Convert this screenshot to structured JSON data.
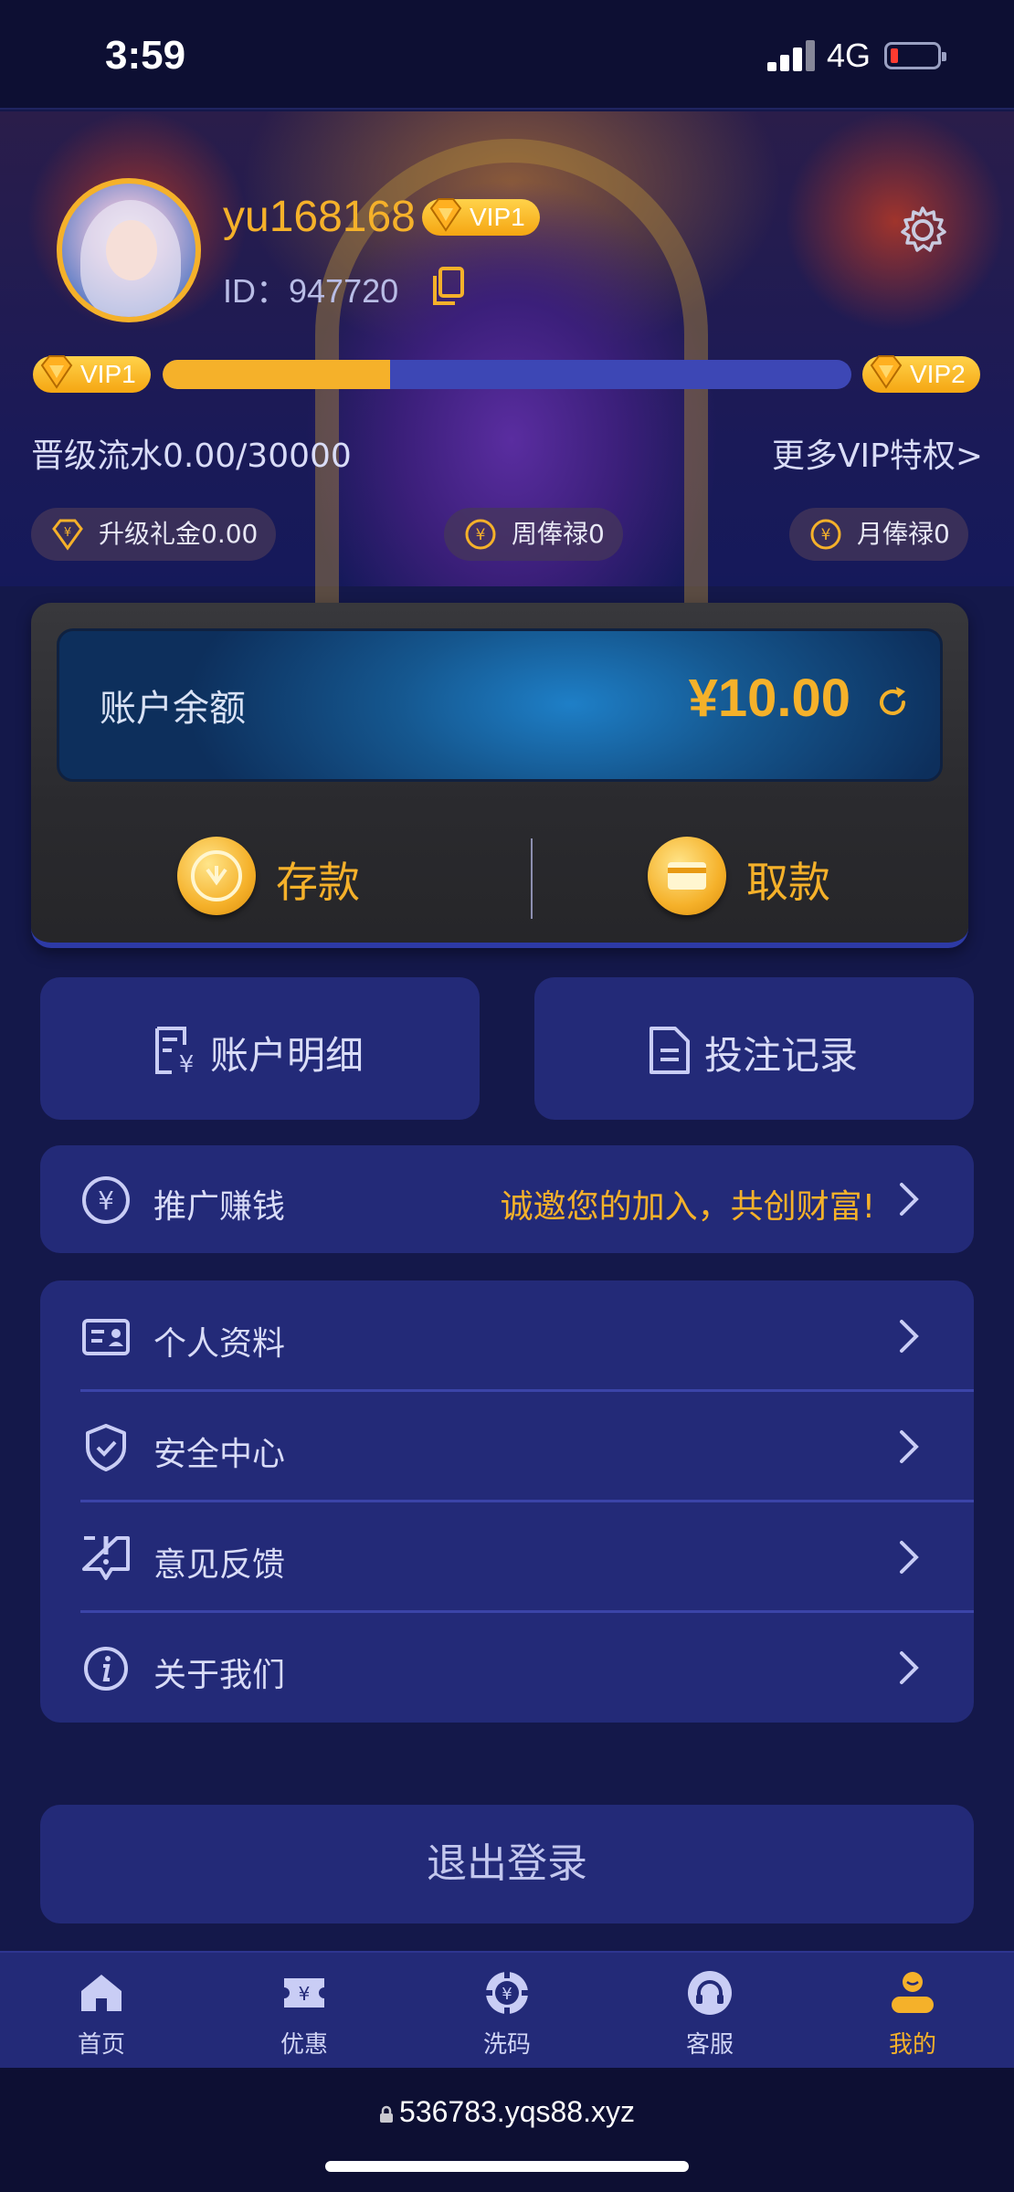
{
  "status": {
    "time": "3:59",
    "network": "4G"
  },
  "profile": {
    "username": "yu168168",
    "vip_badge": "VIP1",
    "id_label": "ID：",
    "id_value": "947720"
  },
  "vip_progress": {
    "current_level": "VIP1",
    "next_level": "VIP2",
    "fraction": 0.33,
    "upgrade_text": "晋级流水0.00/30000",
    "more_link": "更多VIP特权>"
  },
  "rewards": [
    {
      "label": "升级礼金0.00",
      "icon": "diamond-yen-icon"
    },
    {
      "label": "周俸禄0",
      "icon": "yen-coin-icon"
    },
    {
      "label": "月俸禄0",
      "icon": "yen-coin-icon"
    }
  ],
  "balance": {
    "label": "账户余额",
    "amount": "¥10.00",
    "deposit_label": "存款",
    "withdraw_label": "取款"
  },
  "tiles": [
    {
      "label": "账户明细",
      "icon": "account-details-icon"
    },
    {
      "label": "投注记录",
      "icon": "document-icon"
    }
  ],
  "promo": {
    "label": "推广赚钱",
    "slogan": "诚邀您的加入，共创财富!"
  },
  "menu": [
    {
      "label": "个人资料",
      "icon": "id-card-icon"
    },
    {
      "label": "安全中心",
      "icon": "shield-check-icon"
    },
    {
      "label": "意见反馈",
      "icon": "feedback-icon"
    },
    {
      "label": "关于我们",
      "icon": "info-icon"
    }
  ],
  "logout_label": "退出登录",
  "tabbar": [
    {
      "label": "首页",
      "icon": "home-icon",
      "active": false
    },
    {
      "label": "优惠",
      "icon": "ticket-icon",
      "active": false
    },
    {
      "label": "洗码",
      "icon": "chip-icon",
      "active": false
    },
    {
      "label": "客服",
      "icon": "headset-icon",
      "active": false
    },
    {
      "label": "我的",
      "icon": "user-icon",
      "active": true
    }
  ],
  "url": "536783.yqs88.xyz",
  "colors": {
    "accent": "#f5b12a",
    "card": "#232a78",
    "background": "#14184a"
  }
}
